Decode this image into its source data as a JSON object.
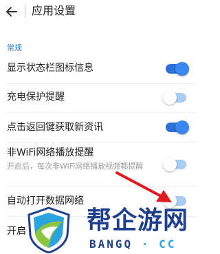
{
  "header": {
    "title": "应用设置"
  },
  "section": {
    "label": "常规"
  },
  "rows": [
    {
      "label": "显示状态栏图标信息",
      "toggle": "on"
    },
    {
      "label": "充电保护提醒",
      "toggle": "off"
    },
    {
      "label": "点击返回键获取新资讯",
      "toggle": "on"
    },
    {
      "label": "非WiFi网络播放提醒",
      "sub": "开启后，每次非WiFi网络播放视频都提醒",
      "toggle": "off"
    },
    {
      "label": "自动打开数据网络",
      "toggle": "off"
    },
    {
      "label": "开启"
    }
  ],
  "watermark": {
    "text": "帮企游网",
    "sub_main": "BANGQ",
    "sub_dot": "·",
    "sub_cc": "CC"
  },
  "colors": {
    "accent": "#2f7fe0",
    "toggle_on": "#3a86f0",
    "toggle_off": "#a9ccf6",
    "arrow": "#e0191e"
  }
}
